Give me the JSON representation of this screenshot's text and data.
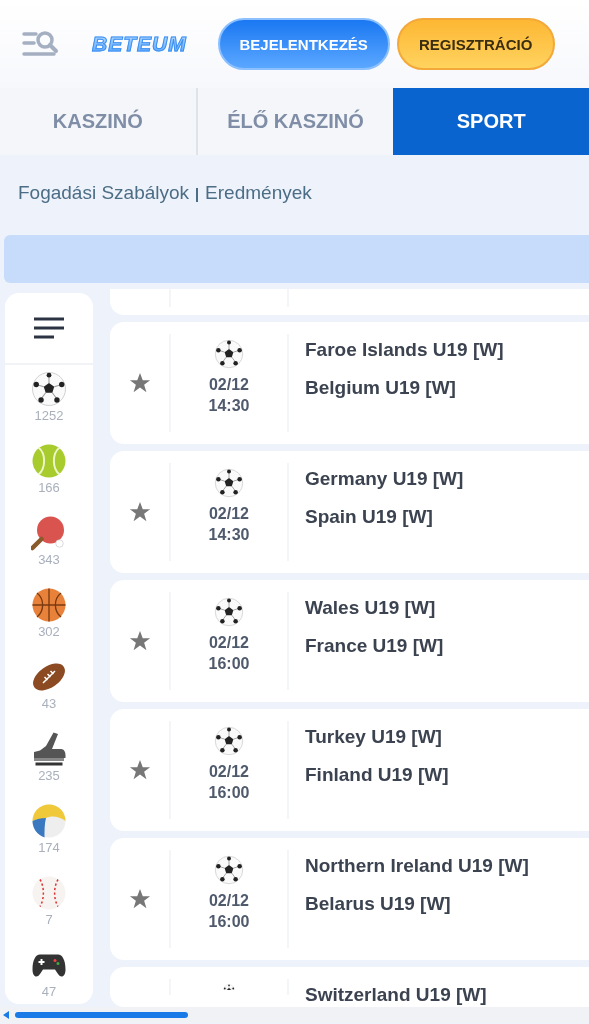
{
  "header": {
    "logo": "BETEUM",
    "login_button": "BEJELENTKEZÉS",
    "register_button": "REGISZTRÁCIÓ"
  },
  "tabs": [
    {
      "label": "KASZINÓ",
      "selected": false
    },
    {
      "label": "ÉLŐ KASZINÓ",
      "selected": false
    },
    {
      "label": "SPORT",
      "selected": true
    }
  ],
  "links": [
    "Fogadási Szabályok",
    "Eredmények"
  ],
  "sports": [
    {
      "kind": "soccer",
      "count": "1252"
    },
    {
      "kind": "tennis",
      "count": "166"
    },
    {
      "kind": "table-tennis",
      "count": "343"
    },
    {
      "kind": "basketball",
      "count": "302"
    },
    {
      "kind": "american-football",
      "count": "43"
    },
    {
      "kind": "skate",
      "count": "235"
    },
    {
      "kind": "volleyball",
      "count": "174"
    },
    {
      "kind": "baseball",
      "count": "7"
    },
    {
      "kind": "esports",
      "count": "47"
    }
  ],
  "matches": [
    {
      "date": "02/12",
      "time": "14:30",
      "teams": [
        "Faroe Islands U19 [W]",
        "Belgium U19 [W]"
      ]
    },
    {
      "date": "02/12",
      "time": "14:30",
      "teams": [
        "Germany U19 [W]",
        "Spain U19 [W]"
      ]
    },
    {
      "date": "02/12",
      "time": "16:00",
      "teams": [
        "Wales U19 [W]",
        "France U19 [W]"
      ]
    },
    {
      "date": "02/12",
      "time": "16:00",
      "teams": [
        "Turkey U19 [W]",
        "Finland U19 [W]"
      ]
    },
    {
      "date": "02/12",
      "time": "16:00",
      "teams": [
        "Northern Ireland U19 [W]",
        "Belarus U19 [W]"
      ]
    },
    {
      "teams": [
        "Switzerland U19 [W]"
      ]
    }
  ]
}
